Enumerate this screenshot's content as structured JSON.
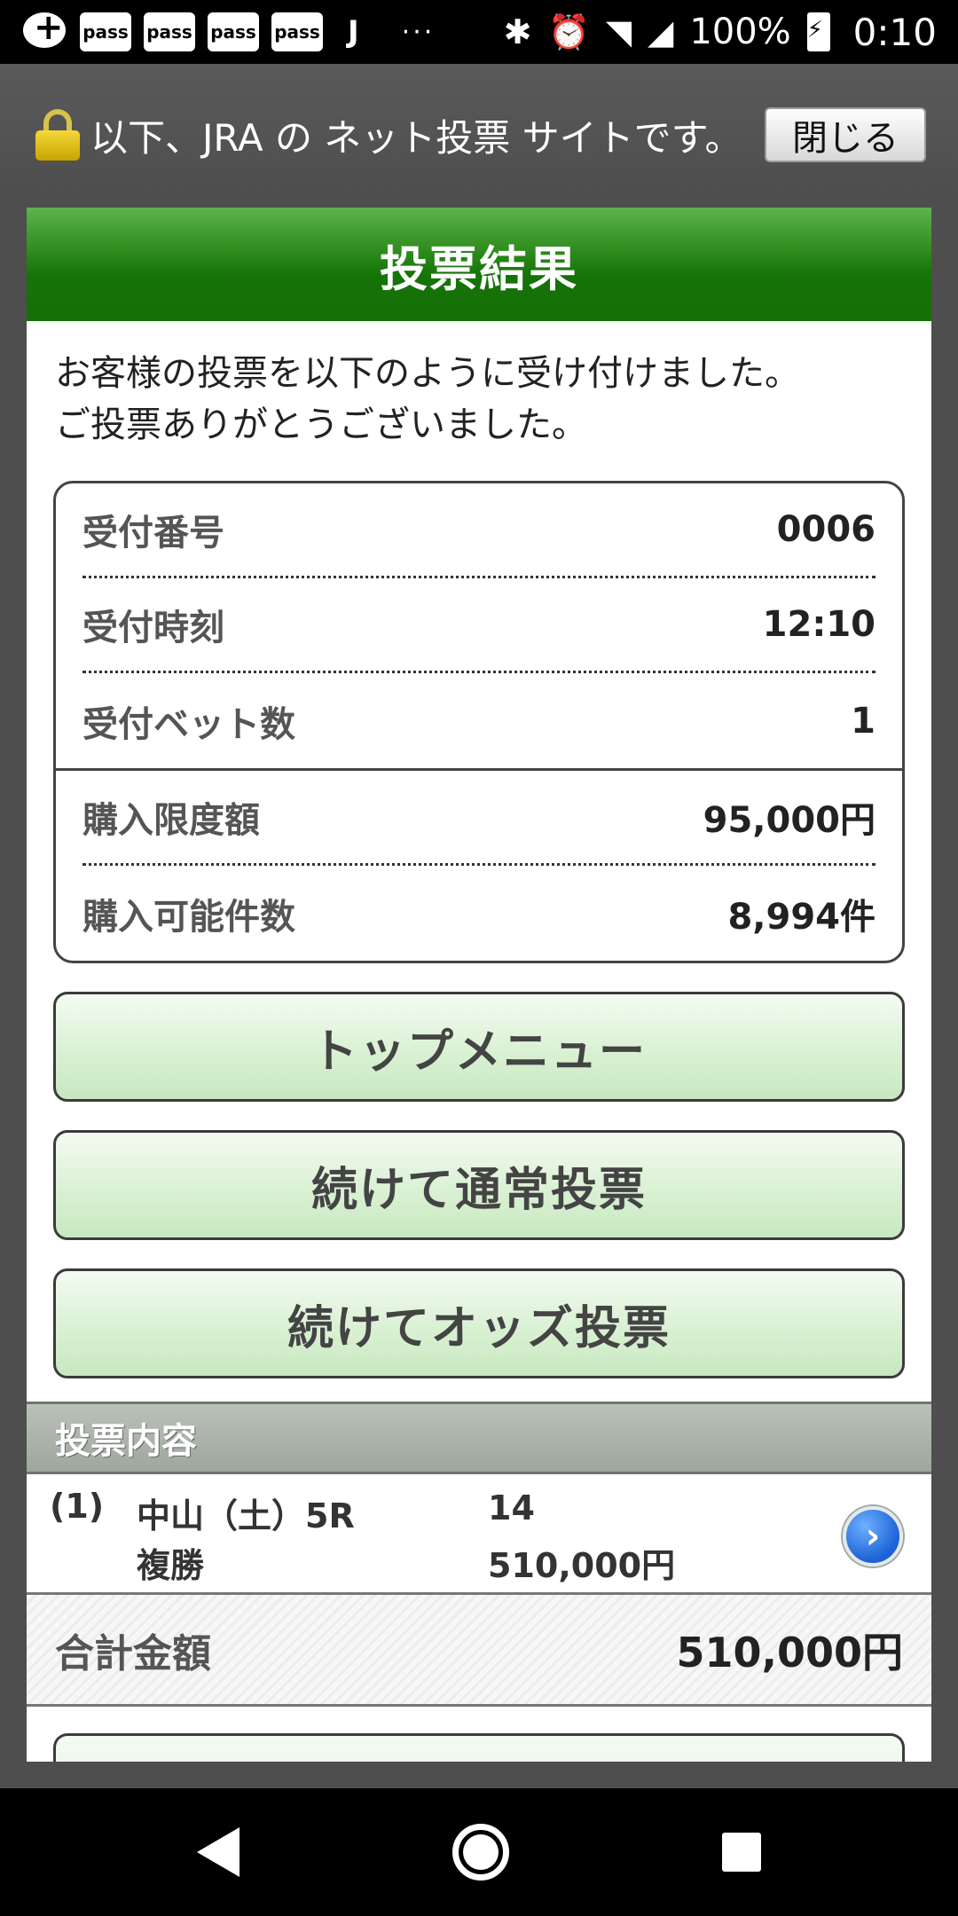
{
  "status_bar": {
    "pass_labels": [
      "pass",
      "pass",
      "pass",
      "pass"
    ],
    "j_label": "J",
    "dots": "···",
    "battery": "100%",
    "time": "0:10"
  },
  "notice": {
    "text": "以下、JRA の ネット投票 サイトです。",
    "close_label": "閉じる"
  },
  "panel": {
    "title": "投票結果",
    "intro_line1": "お客様の投票を以下のように受け付けました。",
    "intro_line2": "ご投票ありがとうございました。"
  },
  "info": {
    "rows": [
      {
        "label": "受付番号",
        "value": "0006"
      },
      {
        "label": "受付時刻",
        "value": "12:10"
      },
      {
        "label": "受付ベット数",
        "value": "1"
      },
      {
        "label": "購入限度額",
        "value": "95,000円"
      },
      {
        "label": "購入可能件数",
        "value": "8,994件"
      }
    ]
  },
  "buttons": {
    "top_menu": "トップメニュー",
    "continue_normal": "続けて通常投票",
    "continue_odds": "続けてオッズ投票"
  },
  "bet_section": {
    "title": "投票内容",
    "bet": {
      "index": "(1)",
      "race": "中山（土）5R",
      "type": "複勝",
      "number": "14",
      "amount": "510,000円"
    },
    "total_label": "合計金額",
    "total_value": "510,000円"
  },
  "colors": {
    "header_green": "#167308",
    "button_green": "#d7f0d1",
    "section_gray": "#9ea69e"
  }
}
